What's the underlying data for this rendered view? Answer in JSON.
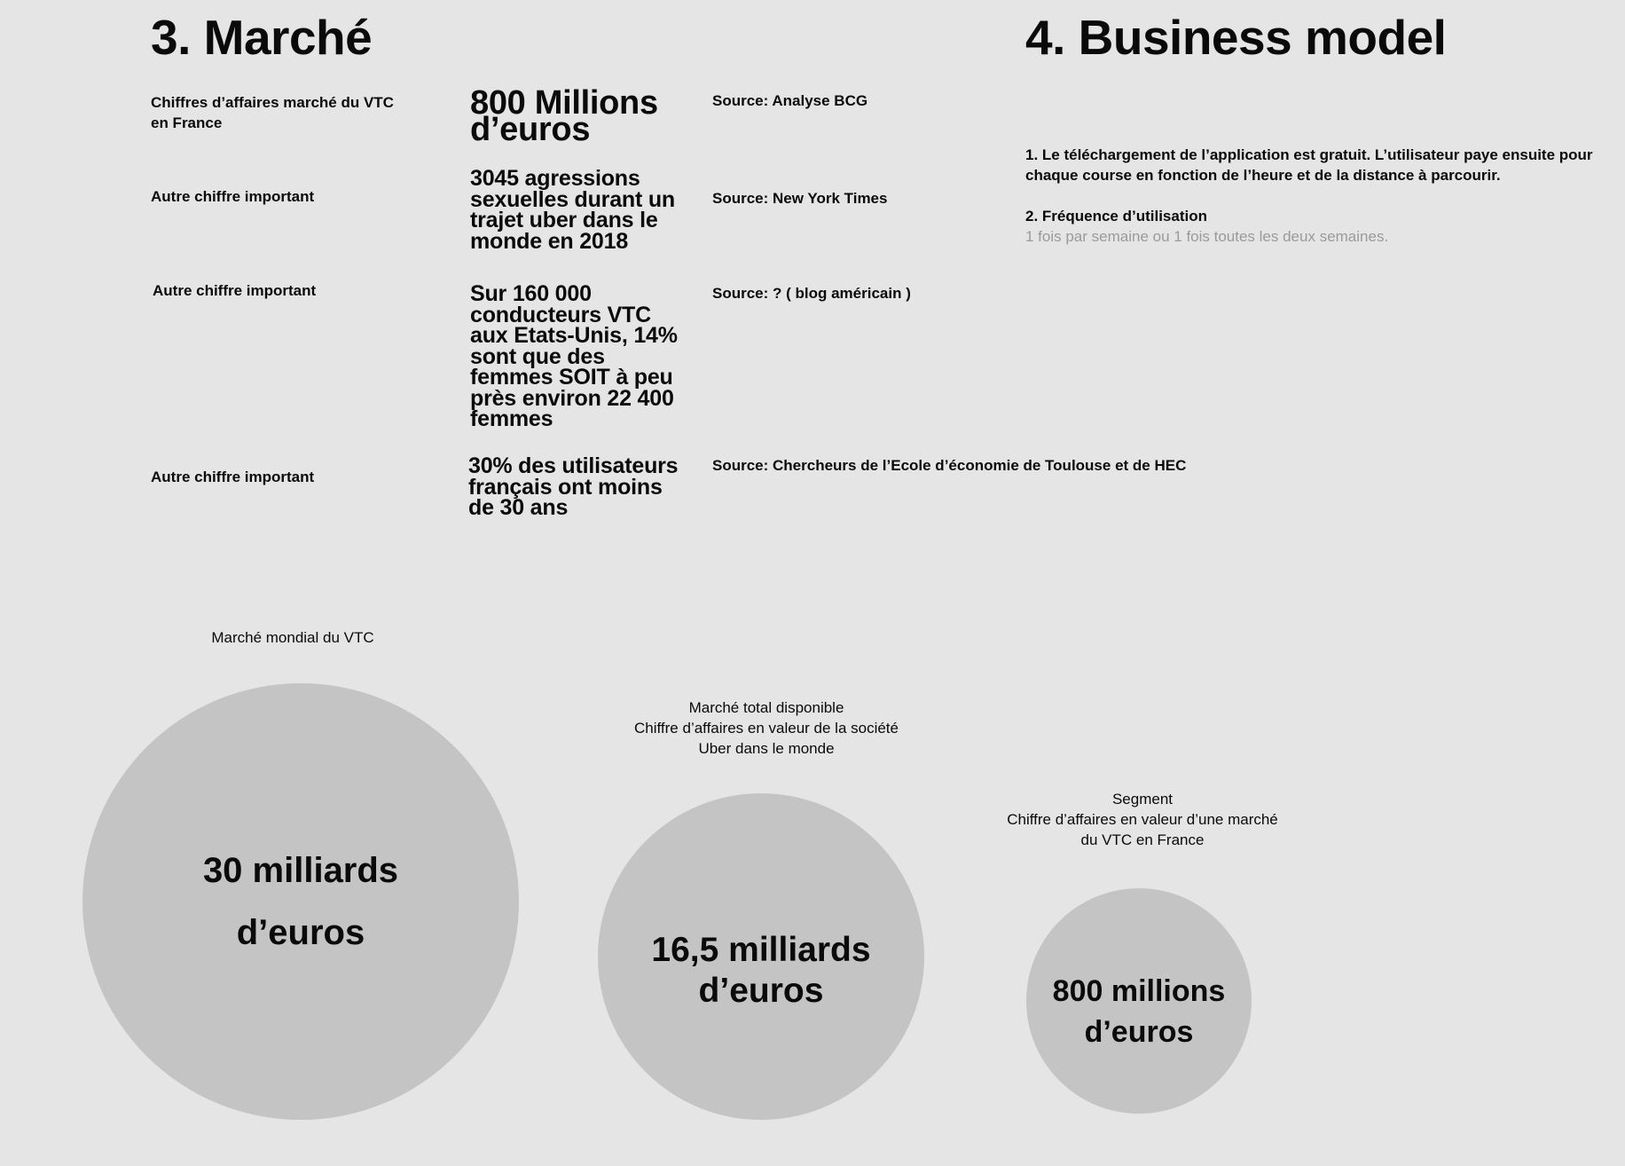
{
  "market": {
    "title": "3. Marché",
    "rows": [
      {
        "label": "Chiffres d’affaires marché du VTC en France",
        "value": "800 Millions d’euros",
        "source": "Source: Analyse BCG"
      },
      {
        "label": "Autre chiffre important",
        "value": "3045 agressions sexuelles durant un trajet uber dans le monde en 2018",
        "source": "Source: New York Times"
      },
      {
        "label": "Autre chiffre important",
        "value": "Sur  160 000 conducteurs VTC aux Etats-Unis, 14% sont que des femmes SOIT à peu près environ 22 400 femmes",
        "source": "Source: ? ( blog américain )"
      },
      {
        "label": "Autre chiffre important",
        "value": "30% des utilisateurs français ont moins de 30 ans",
        "source": "Source: Chercheurs de l’Ecole d’économie de Toulouse et de HEC"
      }
    ]
  },
  "business_model": {
    "title": "4. Business model",
    "p1": "1. Le téléchargement de l’application est gratuit. L’utilisateur paye ensuite pour chaque course en fonction de l’heure et de la distance à parcourir.",
    "p2_title": "2. Fréquence d’utilisation",
    "p2_text": "1 fois par semaine ou 1 fois toutes les deux semaines."
  },
  "circles": {
    "world": {
      "caption": "Marché mondial du VTC",
      "line1": "30 milliards",
      "line2": "d’euros"
    },
    "available": {
      "caption1": "Marché total disponible",
      "caption2": "Chiffre d’affaires en valeur de la société",
      "caption3": "Uber dans le monde",
      "line1": "16,5 milliards",
      "line2": "d’euros"
    },
    "segment": {
      "caption1": "Segment",
      "caption2": "Chiffre d’affaires en valeur d’une marché",
      "caption3": "du VTC en France",
      "line1": "800 millions",
      "line2": "d’euros"
    }
  },
  "colors": {
    "background": "#e5e5e5",
    "circle": "#c4c4c4",
    "muted_text": "#9a9a9a"
  }
}
